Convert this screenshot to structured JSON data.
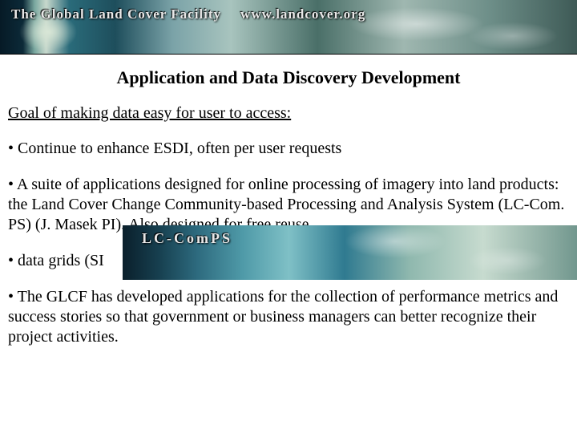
{
  "header": {
    "org": "The Global Land Cover Facility",
    "url": "www.landcover.org"
  },
  "title": "Application and Data Discovery Development",
  "goal": "Goal of making data easy for user to access:",
  "bullets": {
    "b1": "• Continue to enhance ESDI, often per user requests",
    "b2": "• A suite of applications designed for online processing of imagery into land products: the Land Cover Change Community-based Processing and Analysis System (LC-Com. PS) (J. Masek PI). Also designed for free reuse.",
    "b3": "• data grids (SI",
    "b4": "• The GLCF has developed applications for the collection of performance metrics and success stories so that government or business managers can better recognize their project activities."
  },
  "mini_banner": {
    "label": "LC-ComPS"
  }
}
